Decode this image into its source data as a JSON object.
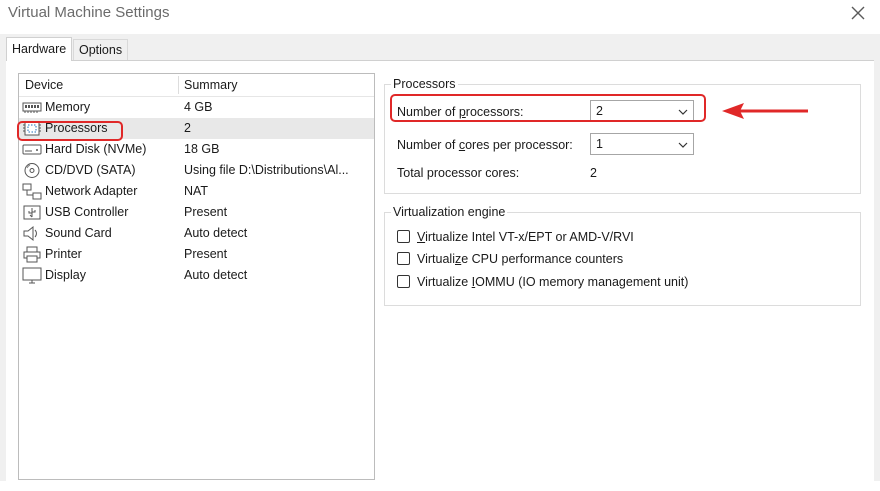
{
  "window": {
    "title": "Virtual Machine Settings"
  },
  "tabs": [
    {
      "label": "Hardware"
    },
    {
      "label": "Options"
    }
  ],
  "device_list": {
    "columns": {
      "device": "Device",
      "summary": "Summary"
    },
    "rows": [
      {
        "icon": "memory-icon",
        "device": "Memory",
        "summary": "4 GB"
      },
      {
        "icon": "processor-icon",
        "device": "Processors",
        "summary": "2"
      },
      {
        "icon": "hard-disk-icon",
        "device": "Hard Disk (NVMe)",
        "summary": "18 GB"
      },
      {
        "icon": "cd-dvd-icon",
        "device": "CD/DVD (SATA)",
        "summary": "Using file D:\\Distributions\\Al..."
      },
      {
        "icon": "network-adapter-icon",
        "device": "Network Adapter",
        "summary": "NAT"
      },
      {
        "icon": "usb-controller-icon",
        "device": "USB Controller",
        "summary": "Present"
      },
      {
        "icon": "sound-card-icon",
        "device": "Sound Card",
        "summary": "Auto detect"
      },
      {
        "icon": "printer-icon",
        "device": "Printer",
        "summary": "Present"
      },
      {
        "icon": "display-icon",
        "device": "Display",
        "summary": "Auto detect"
      }
    ]
  },
  "processors": {
    "title": "Processors",
    "num_processors": {
      "label_before": "Number of ",
      "label_accel": "p",
      "label_after": "rocessors:",
      "value": "2"
    },
    "cores_per_processor": {
      "label_before": "Number of ",
      "label_accel": "c",
      "label_after": "ores per processor:",
      "value": "1"
    },
    "total_cores": {
      "label": "Total processor cores:",
      "value": "2"
    }
  },
  "virtualization": {
    "title": "Virtualization engine",
    "options": [
      {
        "accel": "V",
        "rest": "irtualize Intel VT-x/EPT or AMD-V/RVI",
        "checked": false
      },
      {
        "pre": "Virtuali",
        "accel": "z",
        "rest": "e CPU performance counters",
        "checked": false
      },
      {
        "pre": "Virtualize ",
        "accel": "I",
        "rest": "OMMU (IO memory management unit)",
        "checked": false
      }
    ]
  },
  "colors": {
    "annotation": "#e02828",
    "selected_row": "#e8e8e8",
    "dialog_bg": "#f0f0f0"
  }
}
